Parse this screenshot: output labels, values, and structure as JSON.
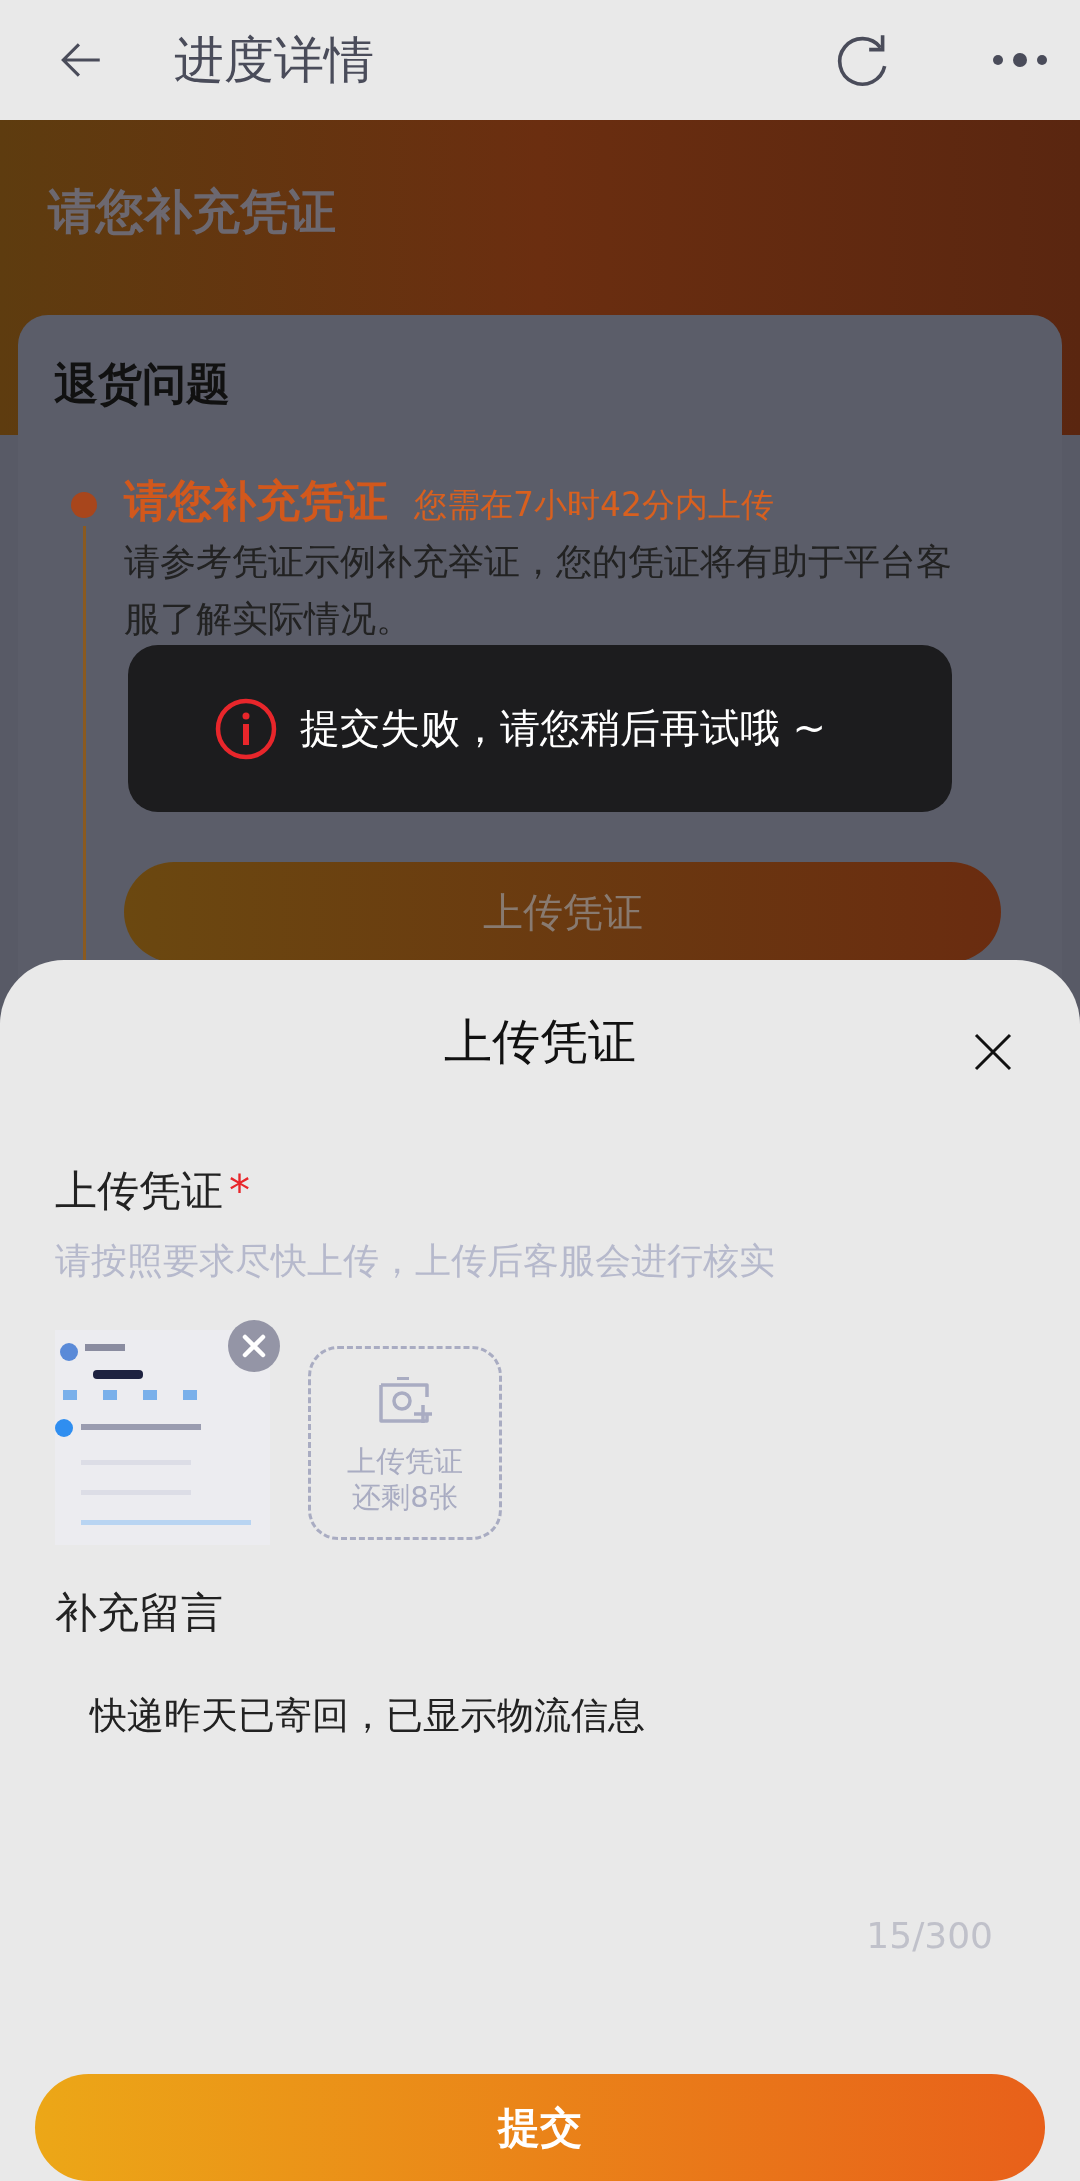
{
  "header": {
    "title": "进度详情"
  },
  "banner": {
    "title": "请您补充凭证"
  },
  "card": {
    "title": "退货问题",
    "step": {
      "title": "请您补充凭证",
      "deadline": "您需在7小时42分内上传",
      "paragraphs": [
        "请参考凭证示例补充举证，您的凭证将有助于平台客服了解实际情况。"
      ]
    },
    "button": "上传凭证"
  },
  "sheet": {
    "title": "上传凭证",
    "upload": {
      "label": "上传凭证",
      "required_mark": "*",
      "hint": "请按照要求尽快上传，上传后客服会进行核实",
      "add_button": {
        "label": "上传凭证",
        "remaining": "还剩8张"
      }
    },
    "message": {
      "label": "补充留言",
      "value": "快递昨天已寄回，已显示物流信息",
      "counter": "15/300"
    },
    "submit": "提交"
  },
  "toast": {
    "text": "提交失败，请您稍后再试哦 ~"
  }
}
